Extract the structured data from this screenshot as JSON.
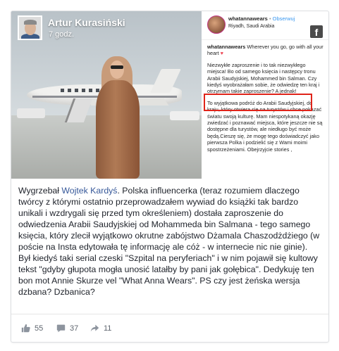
{
  "post": {
    "author": "Artur Kurasiński",
    "time": "7 godz.",
    "text_before_link": "Wygrzebał ",
    "mention": "Wojtek Kardyś",
    "text_after_link": ". Polska influencerka (teraz rozumiem dlaczego twórcy z którymi ostatnio przeprowadzałem wywiad do książki tak bardzo unikali i wzdrygali się przed tym określeniem) dostała zaproszenie do odwiedzenia Arabii Saudyjskiej od Mohammeda bin Salmana - tego samego księcia, który zlecił wyjątkowo okrutne zabójstwo Dżamala Chaszodżdżiego (w poście na Insta edytowała tę informację ale cóż - w internecie nic nie ginie). Był kiedyś taki serial czeski \"Szpital na peryferiach\" i w nim pojawił się kultowy tekst \"gdyby głupota mogła unosić latałby by pani jak gołębica\". Dedykuję ten bon mot Annie Skurze vel \"What Anna Wears\". PS czy jest żeńska wersja dzbana? Dzbanica?"
  },
  "instagram": {
    "username": "whatannawears",
    "separator": " • ",
    "follow": "Obserwuj",
    "location": "Riyadh, Saudi Arabia",
    "caption_user": "whatannawears",
    "caption_first": " Wherever you go, go with all your heart",
    "heart": "♥",
    "para2": "Niezwykłe zaproszenie i to tak niezwykłego miejsca! Bo od samego księcia i następcy tronu Arabii Saudyjskiej, Mohammed bin Salman. Czy kiedyś wyobrażałam sobie, że odwiedzę ten kraj i otrzymam takie zaproszenie? A jednak!",
    "para3": "To wyjątkowa podróż do Arabii Saudyjskiej, do kraju, który otwiera się na turystów i chce pokazać światu swoją kulturę. Mam niespotykaną okazję zwiedzać i poznawać miejsca, które jeszcze nie są dostępne dla turystów, ale niedługo być może będą.Cieszę się, że mogę tego doświadczyć jako pierwsza Polka i podzielić się z Wami moimi spostrzeżeniami. Obejrzyjcie stories ,"
  },
  "badge": {
    "letter": "f"
  },
  "actions": {
    "likes": "55",
    "comments": "37",
    "shares": "11"
  },
  "colors": {
    "link": "#365899",
    "insta_follow": "#3897f0",
    "highlight_box": "#e0241a"
  }
}
